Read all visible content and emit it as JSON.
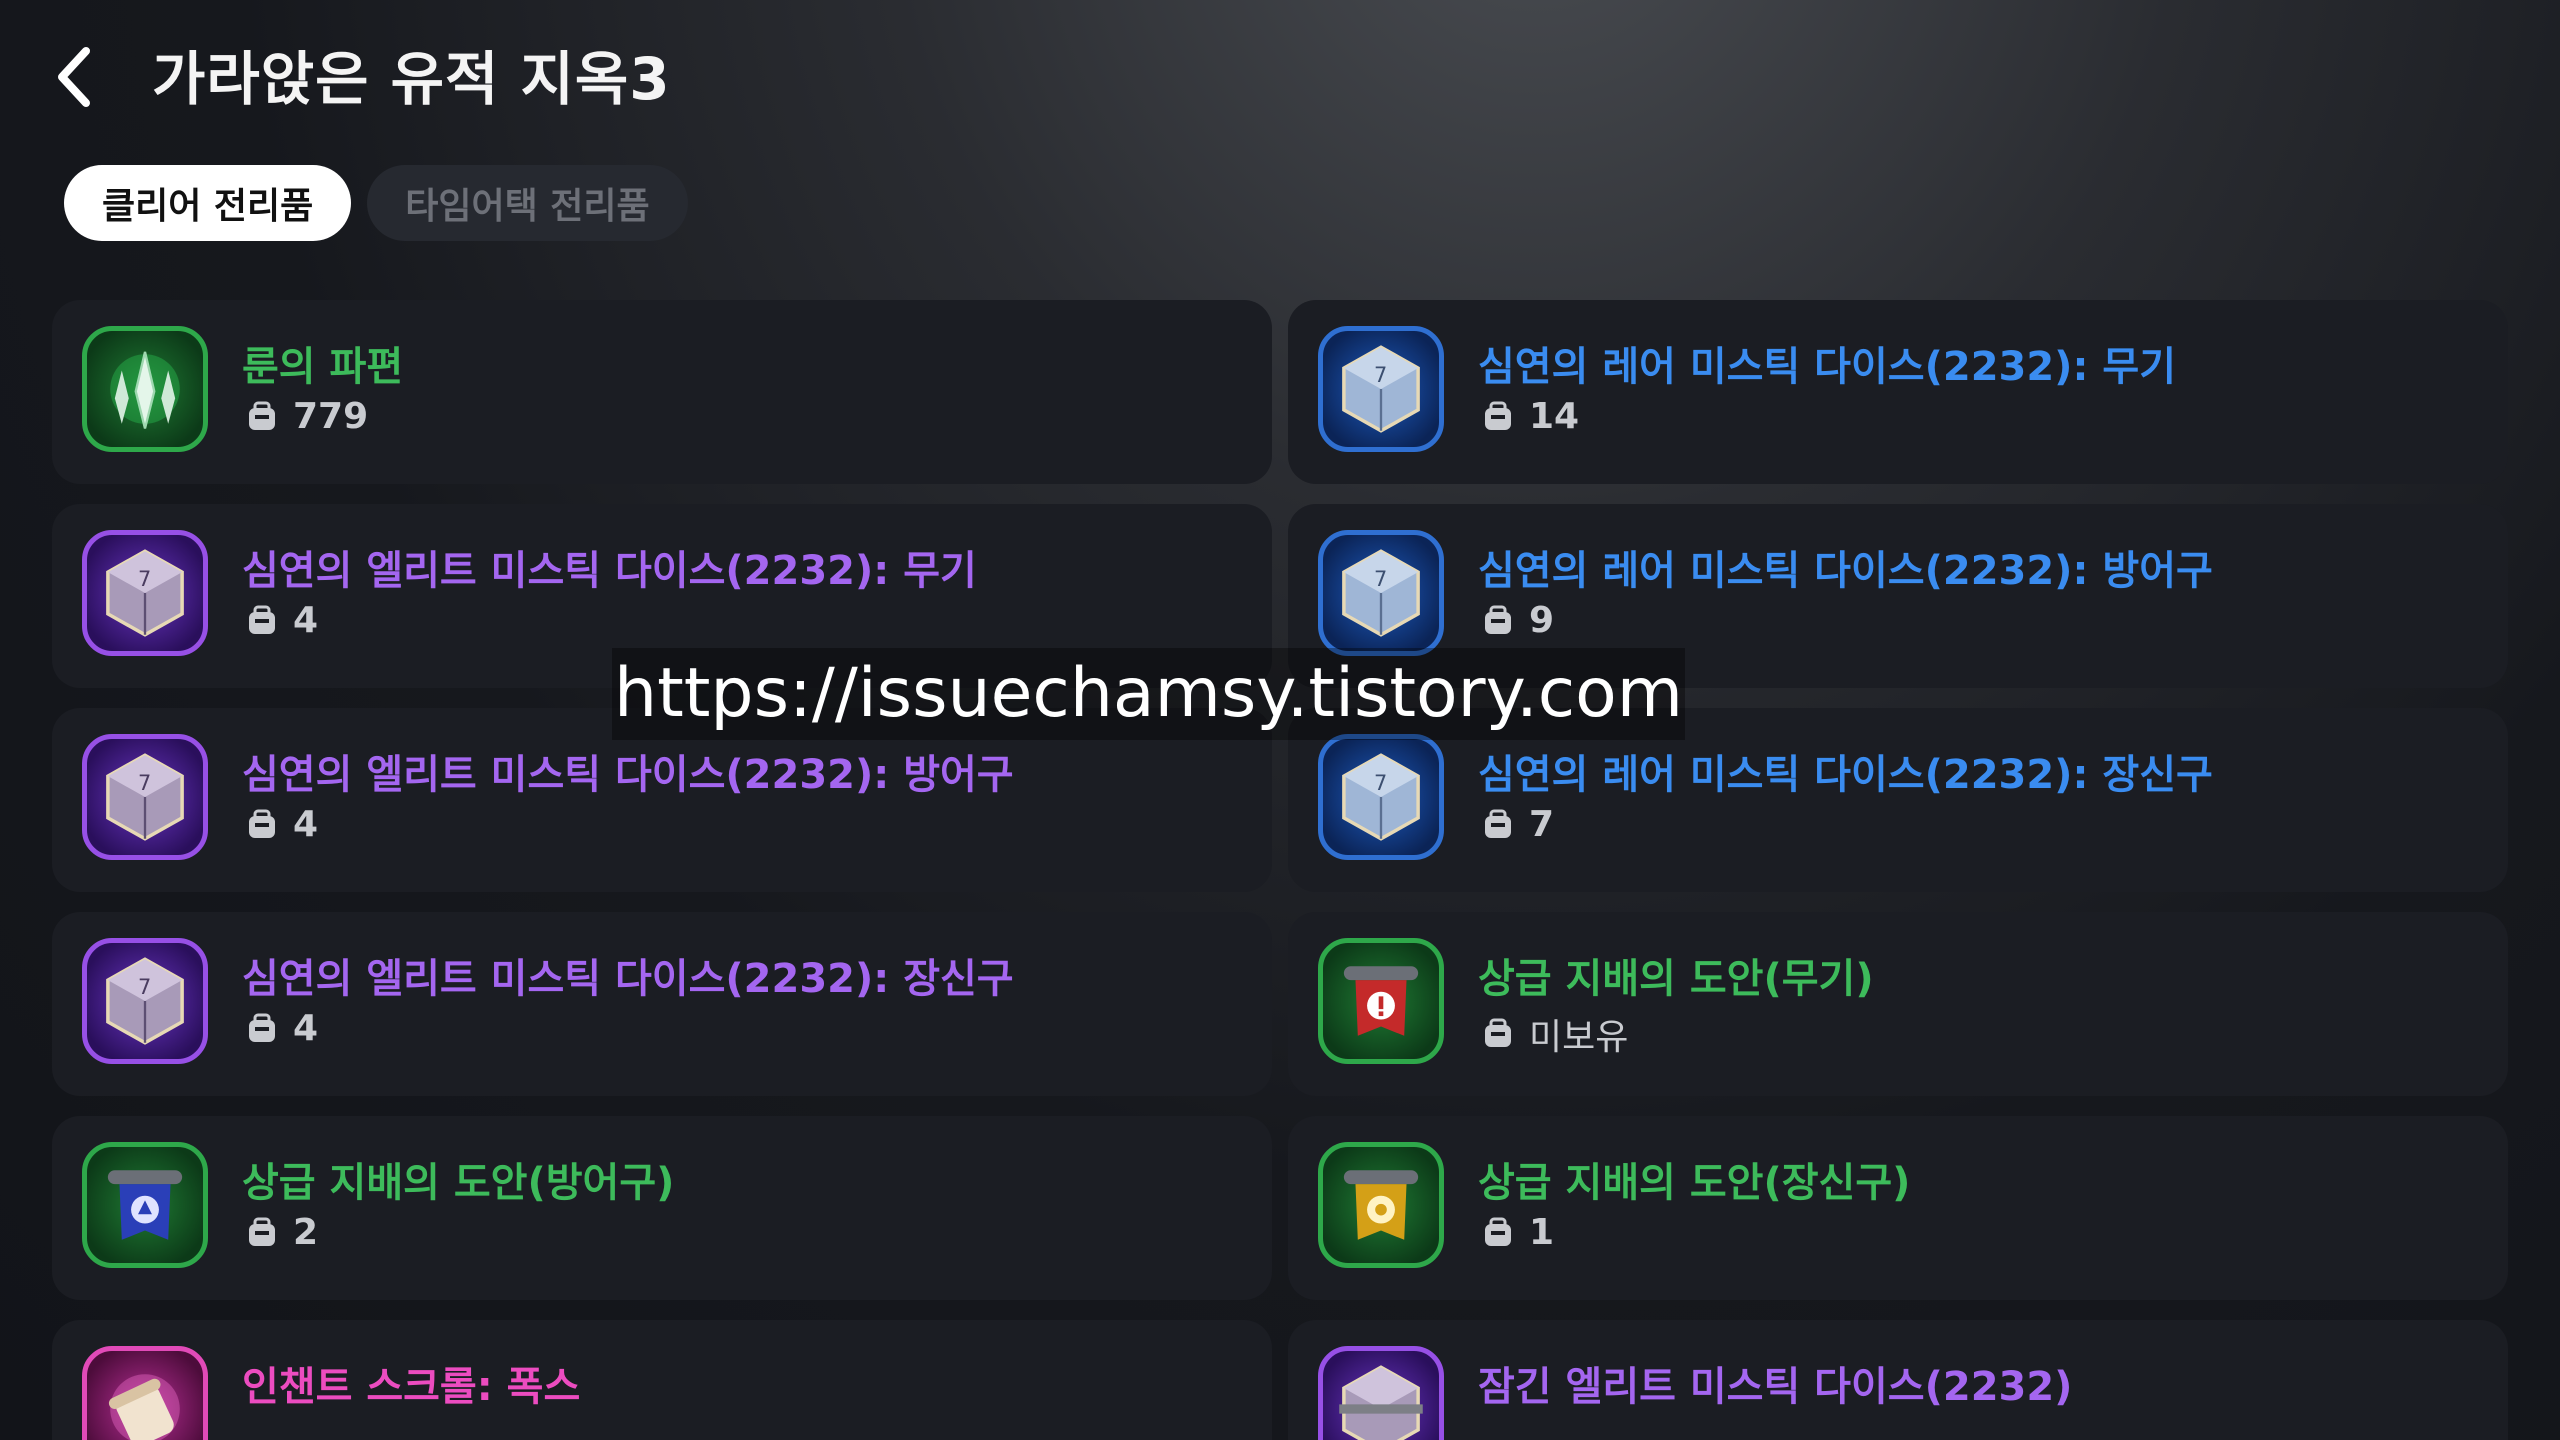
{
  "header": {
    "title": "가라앉은 유적 지옥3"
  },
  "tabs": [
    {
      "label": "클리어 전리품",
      "active": true
    },
    {
      "label": "타임어택 전리품",
      "active": false
    }
  ],
  "colors": {
    "green": "#3dbb5b",
    "blue": "#3a8cf0",
    "purple": "#a466f0",
    "pink": "#ec4cc0"
  },
  "items": [
    {
      "name": "룬의 파편",
      "qty": "779",
      "grade": "green",
      "icon": "rune-shard-icon"
    },
    {
      "name": "심연의 레어 미스틱 다이스(2232): 무기",
      "qty": "14",
      "grade": "blue",
      "icon": "dice-icon"
    },
    {
      "name": "심연의 엘리트 미스틱 다이스(2232): 무기",
      "qty": "4",
      "grade": "purple",
      "icon": "dice-icon"
    },
    {
      "name": "심연의 레어 미스틱 다이스(2232): 방어구",
      "qty": "9",
      "grade": "blue",
      "icon": "dice-icon"
    },
    {
      "name": "심연의 엘리트 미스틱 다이스(2232): 방어구",
      "qty": "4",
      "grade": "purple",
      "icon": "dice-icon"
    },
    {
      "name": "심연의 레어 미스틱 다이스(2232): 장신구",
      "qty": "7",
      "grade": "blue",
      "icon": "dice-icon"
    },
    {
      "name": "심연의 엘리트 미스틱 다이스(2232): 장신구",
      "qty": "4",
      "grade": "purple",
      "icon": "dice-icon"
    },
    {
      "name": "상급 지배의 도안(무기)",
      "qty": "미보유",
      "grade": "green",
      "icon": "blueprint-scroll-icon"
    },
    {
      "name": "상급 지배의 도안(방어구)",
      "qty": "2",
      "grade": "green",
      "icon": "blueprint-scroll-icon"
    },
    {
      "name": "상급 지배의 도안(장신구)",
      "qty": "1",
      "grade": "green",
      "icon": "blueprint-scroll-icon"
    },
    {
      "name": "인챈트 스크롤: 폭스",
      "qty": "",
      "grade": "pink",
      "icon": "enchant-scroll-icon"
    },
    {
      "name": "잠긴 엘리트 미스틱 다이스(2232)",
      "qty": "",
      "grade": "purple",
      "icon": "locked-dice-icon"
    }
  ],
  "watermark": "https://issuechamsy.tistory.com"
}
